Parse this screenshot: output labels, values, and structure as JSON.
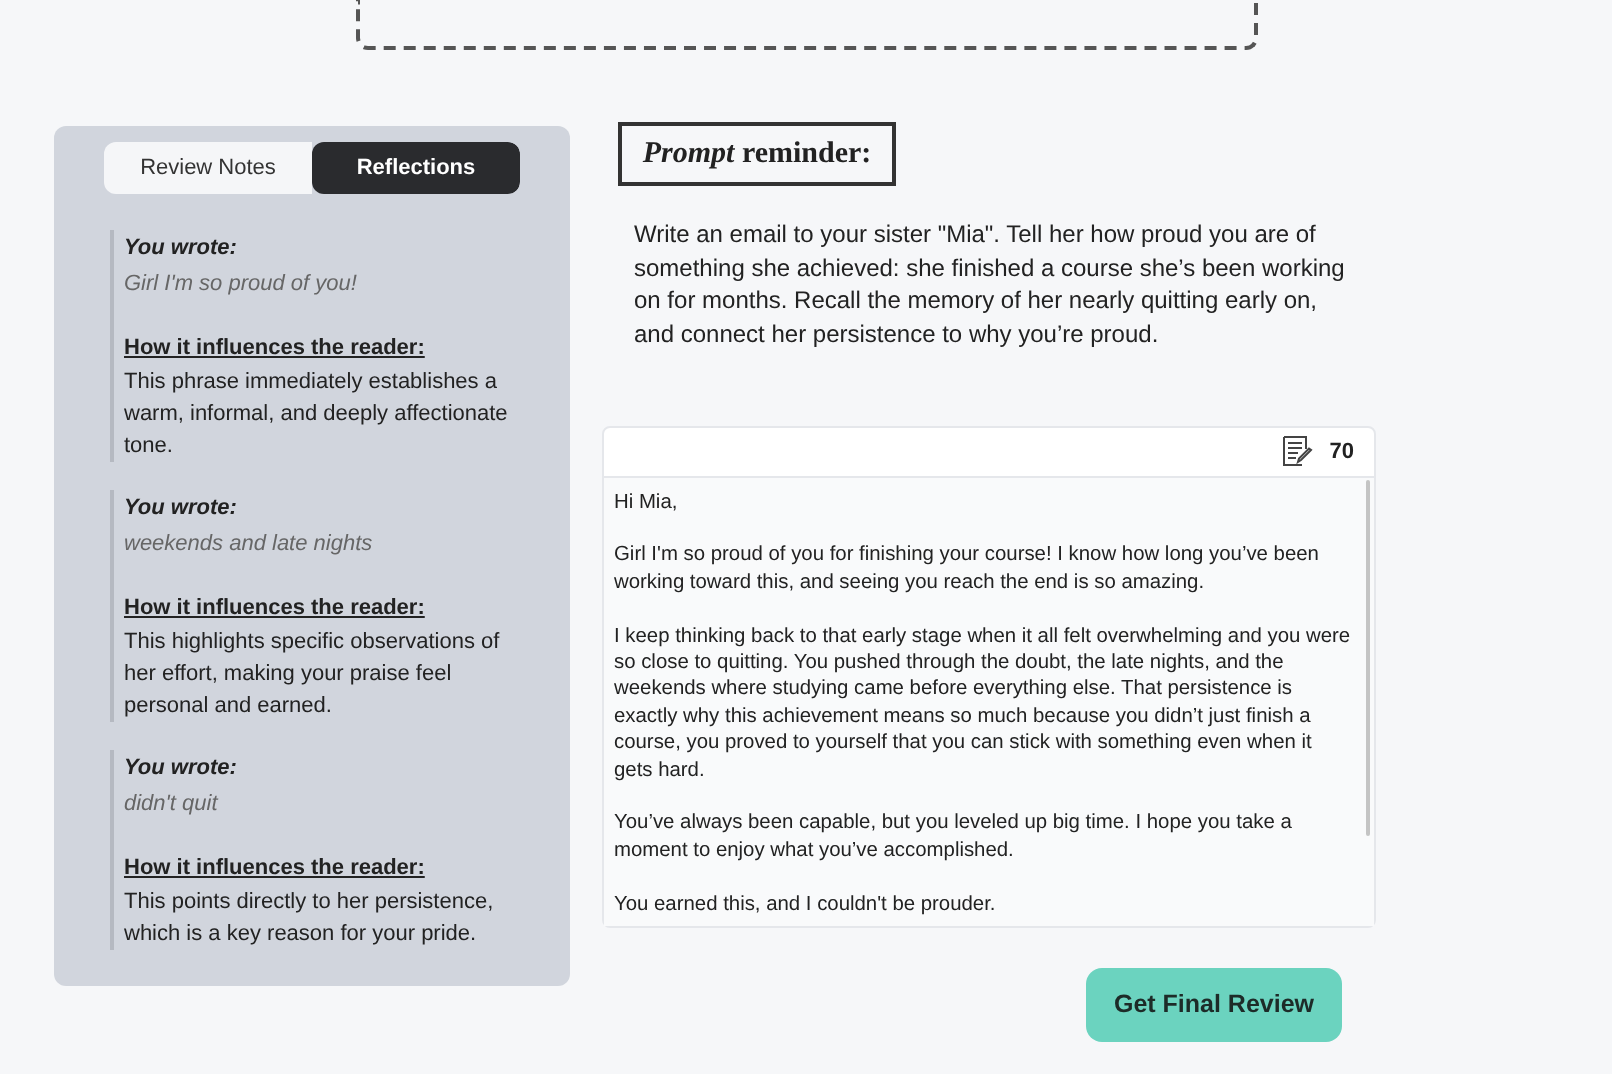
{
  "tabs": [
    {
      "label": "Review Notes",
      "selected": false
    },
    {
      "label": "Reflections",
      "selected": true
    }
  ],
  "reflections": [
    {
      "heading": "You wrote:",
      "quote": "Girl I'm so proud of you!",
      "influence_heading": "How it influences the reader:",
      "influence": "This phrase immediately establishes a warm, informal, and deeply affectionate tone."
    },
    {
      "heading": "You wrote:",
      "quote": "weekends and late nights",
      "influence_heading": "How it influences the reader:",
      "influence": "This highlights specific observations of her effort, making your praise feel personal and earned."
    },
    {
      "heading": "You wrote:",
      "quote": "didn't quit",
      "influence_heading": "How it influences the reader:",
      "influence": "This points directly to her persistence, which is a key reason for your pride."
    }
  ],
  "prompt": {
    "title": "*Prompt* reminder:",
    "text": "Write an email to your sister \"Mia\". Tell her how proud you are of something she achieved: she finished a course she’s been working on for months. Recall the memory of her nearly quitting early on, and connect her persistence to why you’re proud."
  },
  "editor": {
    "word_count": "70",
    "paragraphs": [
      "Hi Mia,",
      "Girl I'm so proud of you for finishing your course! I know how long you’ve been working toward this, and seeing you reach the end is so amazing.",
      "I keep thinking back to that early stage when it all felt overwhelming and you were so close to quitting. You pushed through the doubt, the late nights, and the weekends where studying came before everything else. That persistence is exactly why this achievement means so much because you didn’t just finish a course, you proved to yourself that you can stick with something even when it gets hard.",
      "You’ve always been capable, but you leveled up big time. I hope you take a moment to enjoy what you’ve accomplished.",
      "You earned this, and I couldn't be prouder."
    ]
  },
  "submit_button": "Get Final Review"
}
